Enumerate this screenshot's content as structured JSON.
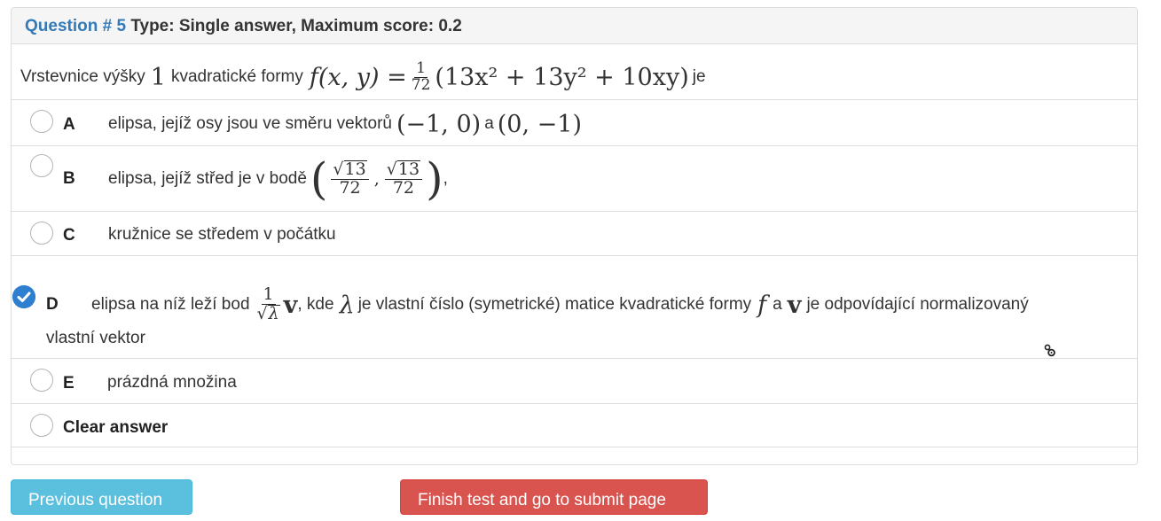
{
  "header": {
    "question_label": "Question # 5",
    "type_label": "Type: Single answer, Maximum score: 0.2"
  },
  "question": {
    "text_before": "Vrstevnice výšky",
    "height_value": "1",
    "text_mid": "kvadratické formy",
    "formula_lhs": "f(x, y) =",
    "fraction_num": "1",
    "fraction_den": "72",
    "formula_rhs": "(13x² + 13y² + 10xy)",
    "text_after": "je"
  },
  "answers": [
    {
      "letter": "A",
      "text": "elipsa, jejíž osy jsou ve směru vektorů",
      "vec1": "(−1, 0)",
      "conj": "a",
      "vec2": "(0, −1)",
      "selected": false
    },
    {
      "letter": "B",
      "text": "elipsa, jejíž střed je v bodě",
      "sqrt_val": "13",
      "den": "72",
      "comma": ",",
      "selected": false
    },
    {
      "letter": "C",
      "text": "kružnice se středem v počátku",
      "selected": false
    },
    {
      "letter": "D",
      "text": "elipsa na níž leží bod",
      "frac_num": "1",
      "lambda": "λ",
      "vec": "v",
      "text2": ", kde",
      "text3": "je vlastní číslo (symetrické) matice kvadratické formy",
      "f": "f",
      "text4": "a",
      "text5": "je odpovídající normalizovaný",
      "text6": "vlastní vektor",
      "selected": true
    },
    {
      "letter": "E",
      "text": "prázdná množina",
      "selected": false
    }
  ],
  "clear_answer": "Clear answer",
  "buttons": {
    "previous": "Previous question",
    "finish": "Finish test and go to submit page"
  },
  "colors": {
    "accent": "#337ab7",
    "checked": "#2e7fd0",
    "info_button": "#5bc0de",
    "danger_button": "#d9534f"
  },
  "icons": {
    "selected_radio": "check-circle-icon",
    "cursor": "gear-cursor-icon"
  }
}
